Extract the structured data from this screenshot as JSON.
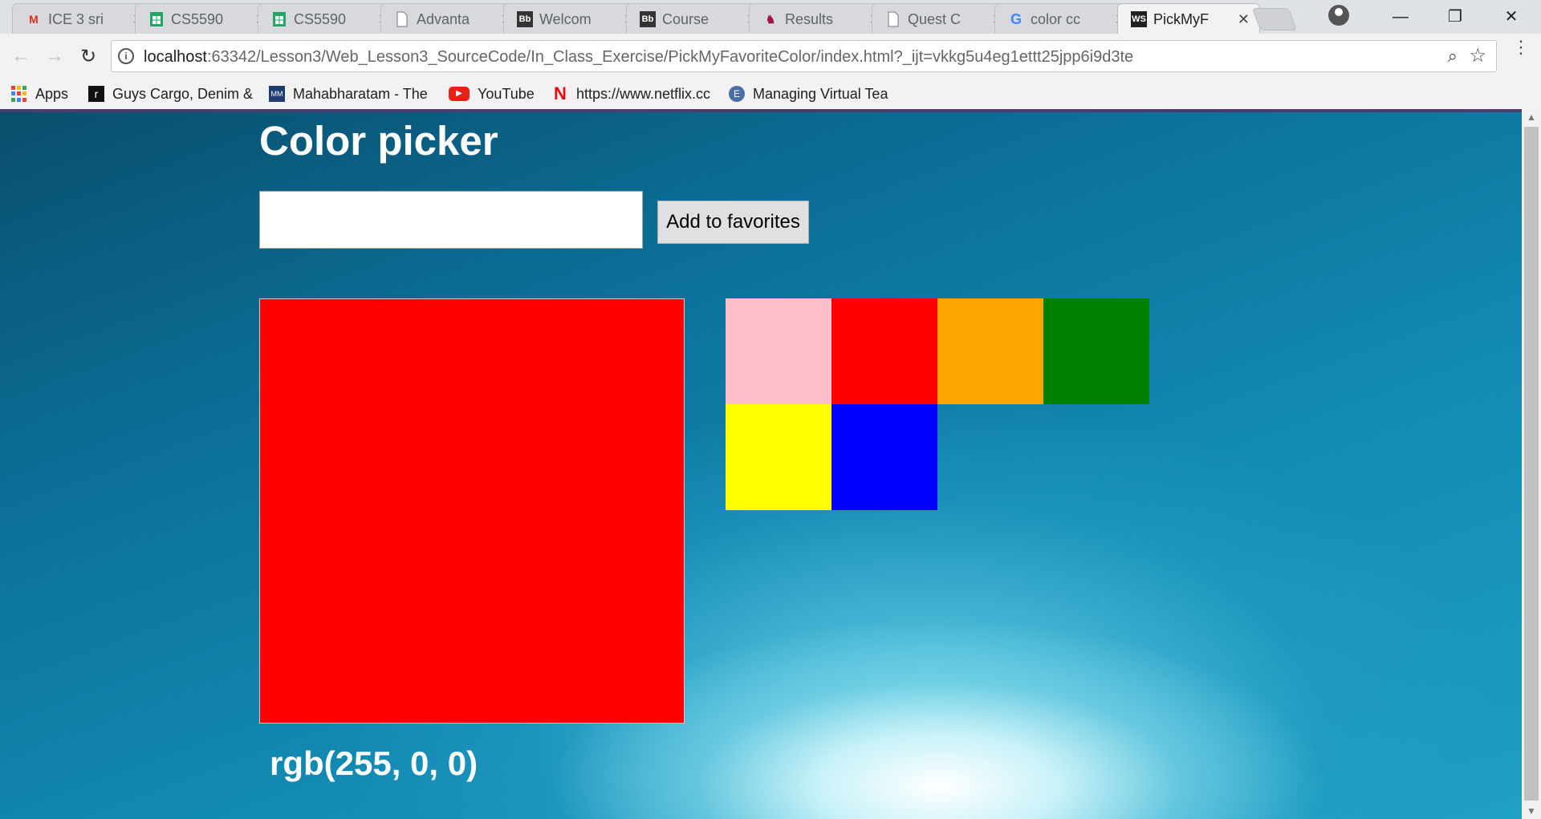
{
  "browser": {
    "tabs": [
      {
        "title": "ICE 3 sri",
        "icon": "gmail-icon"
      },
      {
        "title": "CS5590",
        "icon": "sheets-icon"
      },
      {
        "title": "CS5590",
        "icon": "sheets-icon"
      },
      {
        "title": "Advanta",
        "icon": "page-icon"
      },
      {
        "title": "Welcom",
        "icon": "blackboard-icon"
      },
      {
        "title": "Course",
        "icon": "blackboard-icon"
      },
      {
        "title": "Results",
        "icon": "roo-icon"
      },
      {
        "title": "Quest C",
        "icon": "page-icon"
      },
      {
        "title": "color cc",
        "icon": "google-icon"
      },
      {
        "title": "PickMyF",
        "icon": "webstorm-icon",
        "active": true
      }
    ],
    "url_host": "localhost",
    "url_rest": ":63342/Lesson3/Web_Lesson3_SourceCode/In_Class_Exercise/PickMyFavoriteColor/index.html?_ijt=vkkg5u4eg1ettt25jpp6i9d3te",
    "bookmarks": [
      {
        "label": "Apps",
        "icon": "apps-icon"
      },
      {
        "label": "Guys Cargo, Denim &",
        "icon": "guys-cargo-icon"
      },
      {
        "label": "Mahabharatam - The",
        "icon": "mahabharatam-icon"
      },
      {
        "label": "YouTube",
        "icon": "youtube-icon"
      },
      {
        "label": "https://www.netflix.cc",
        "icon": "netflix-icon"
      },
      {
        "label": "Managing Virtual Tea",
        "icon": "edx-icon"
      }
    ]
  },
  "page": {
    "title": "Color picker",
    "input_value": "",
    "add_button_label": "Add to favorites",
    "selected_color": "#ff0000",
    "selected_rgb_text": "rgb(255, 0, 0)",
    "favorites": [
      {
        "name": "pink",
        "hex": "#ffc0cb"
      },
      {
        "name": "red",
        "hex": "#ff0000"
      },
      {
        "name": "orange",
        "hex": "#ffa500"
      },
      {
        "name": "green",
        "hex": "#008000"
      },
      {
        "name": "yellow",
        "hex": "#ffff00"
      },
      {
        "name": "blue",
        "hex": "#0000ff"
      }
    ]
  }
}
